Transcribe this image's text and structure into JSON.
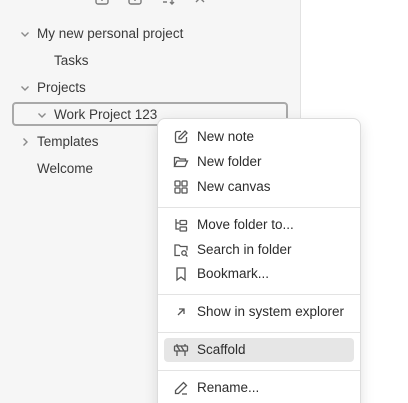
{
  "toolbar": {
    "icons": [
      "new-note-icon",
      "new-folder-icon",
      "sort-icon",
      "collapse-icon"
    ]
  },
  "tree": {
    "items": [
      {
        "label": "My new personal project",
        "expanded": true
      },
      {
        "label": "Tasks"
      },
      {
        "label": "Projects",
        "expanded": true
      },
      {
        "label": "Work Project 123",
        "expanded": true,
        "selected": true
      },
      {
        "label": "Templates",
        "expanded": false
      },
      {
        "label": "Welcome"
      }
    ]
  },
  "context_menu": {
    "items": [
      {
        "label": "New note",
        "icon": "edit-icon"
      },
      {
        "label": "New folder",
        "icon": "folder-open-icon"
      },
      {
        "label": "New canvas",
        "icon": "canvas-icon"
      },
      {
        "label": "Move folder to...",
        "icon": "folder-tree-icon"
      },
      {
        "label": "Search in folder",
        "icon": "folder-search-icon"
      },
      {
        "label": "Bookmark...",
        "icon": "bookmark-icon"
      },
      {
        "label": "Show in system explorer",
        "icon": "arrow-up-right-icon"
      },
      {
        "label": "Scaffold",
        "icon": "scaffold-icon",
        "hovered": true
      },
      {
        "label": "Rename...",
        "icon": "pencil-icon"
      }
    ]
  }
}
